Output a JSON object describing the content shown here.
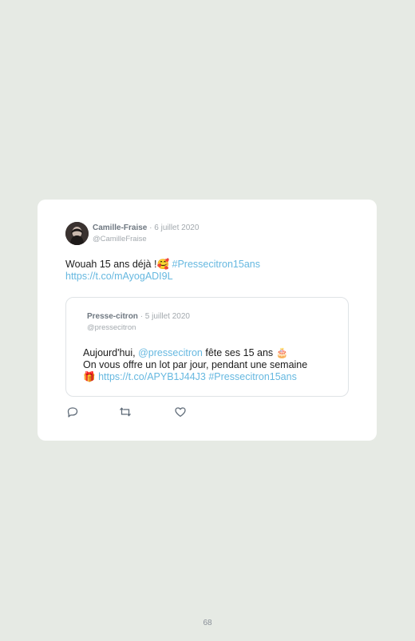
{
  "tweet": {
    "author_name": "Camille-Fraise",
    "date": "· 6 juillet 2020",
    "handle": "@CamilleFraise",
    "text_before": "Wouah 15 ans déjà !",
    "emoji": "🥰",
    "hashtag": "#Pressecitron15ans",
    "link": "https://t.co/mAyogADI9L"
  },
  "quoted_tweet": {
    "author_name": "Presse-citron",
    "date": "· 5 juillet 2020",
    "handle": "@pressecitron",
    "line1_before": "Aujourd'hui, ",
    "line1_mention": "@pressecitron",
    "line1_after": " fête ses 15 ans",
    "line1_emoji": "🎂",
    "line2": "On vous offre un lot par jour, pendant une semaine",
    "line3_emoji": "🎁",
    "line3_link": "https://t.co/APYB1J44J3",
    "line3_hashtag": "#Pressecitron15ans"
  },
  "actions": {
    "reply_icon": "reply-icon",
    "retweet_icon": "retweet-icon",
    "like_icon": "heart-icon"
  },
  "page_number": "68",
  "colors": {
    "background": "#e6eae4",
    "card": "#ffffff",
    "link": "#66b8e0",
    "muted": "#a3a9ae"
  }
}
